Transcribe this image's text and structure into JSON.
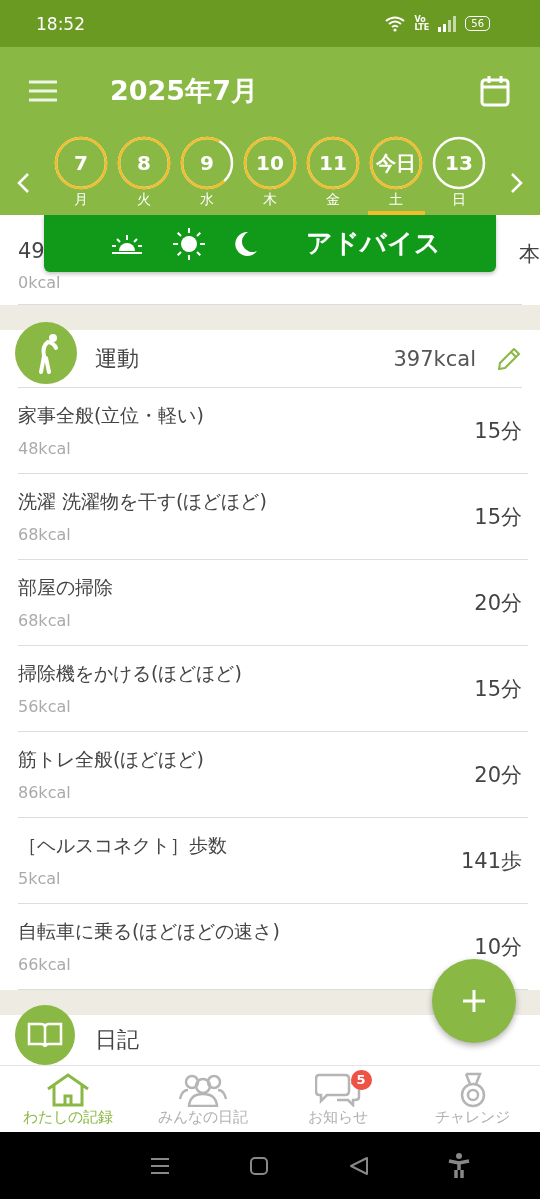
{
  "status_bar": {
    "time": "18:52",
    "volte": [
      "Vo",
      "LTE"
    ],
    "battery": "56"
  },
  "header": {
    "title": "2025年7月"
  },
  "days": [
    {
      "date": "7",
      "weekday": "月",
      "kind": "full",
      "selected": false
    },
    {
      "date": "8",
      "weekday": "火",
      "kind": "full",
      "selected": false
    },
    {
      "date": "9",
      "weekday": "水",
      "kind": "partial",
      "selected": false
    },
    {
      "date": "10",
      "weekday": "木",
      "kind": "full",
      "selected": false
    },
    {
      "date": "11",
      "weekday": "金",
      "kind": "full",
      "selected": false
    },
    {
      "date": "今日",
      "weekday": "土",
      "kind": "full",
      "selected": true
    },
    {
      "date": "13",
      "weekday": "日",
      "kind": "empty",
      "selected": false
    }
  ],
  "advice": {
    "label": "アドバイス"
  },
  "partial_row": {
    "name": "49",
    "amount": "本",
    "kcal": "0kcal"
  },
  "exercise": {
    "title": "運動",
    "total": "397kcal",
    "items": [
      {
        "name": "家事全般(立位・軽い)",
        "kcal": "48kcal",
        "amount": "15分"
      },
      {
        "name": "洗濯 洗濯物を干す(ほどほど)",
        "kcal": "68kcal",
        "amount": "15分"
      },
      {
        "name": "部屋の掃除",
        "kcal": "68kcal",
        "amount": "20分"
      },
      {
        "name": "掃除機をかける(ほどほど)",
        "kcal": "56kcal",
        "amount": "15分"
      },
      {
        "name": "筋トレ全般(ほどほど)",
        "kcal": "86kcal",
        "amount": "20分"
      },
      {
        "name": "［ヘルスコネクト］歩数",
        "kcal": "5kcal",
        "amount": "141歩"
      },
      {
        "name": "自転車に乗る(ほどほどの速さ)",
        "kcal": "66kcal",
        "amount": "10分"
      }
    ]
  },
  "diary": {
    "title": "日記"
  },
  "nav": [
    {
      "label": "わたしの記録",
      "kind": "home",
      "selected": true
    },
    {
      "label": "みんなの日記",
      "kind": "people",
      "selected": false
    },
    {
      "label": "お知らせ",
      "kind": "chat",
      "selected": false,
      "badge": "5"
    },
    {
      "label": "チャレンジ",
      "kind": "medal",
      "selected": false
    }
  ]
}
